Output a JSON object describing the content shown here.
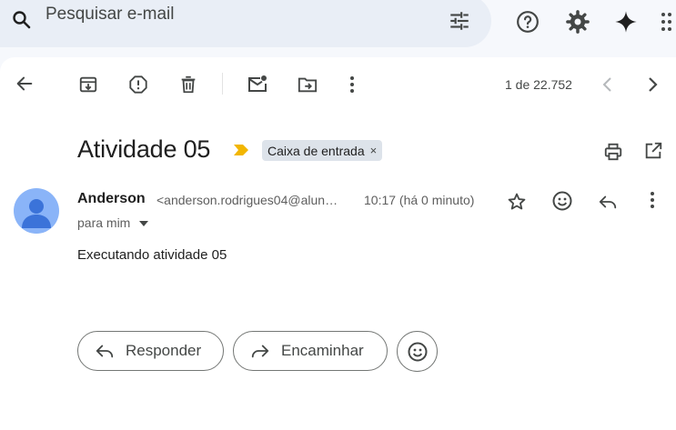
{
  "search": {
    "placeholder": "Pesquisar e-mail"
  },
  "toolbar": {
    "counter": "1 de 22.752"
  },
  "message": {
    "subject": "Atividade 05",
    "label": "Caixa de entrada",
    "label_remove": "×",
    "sender_name": "Anderson",
    "sender_email": "<anderson.rodrigues04@alun…",
    "time": "10:17 (há 0 minuto)",
    "recipient": "para mim",
    "body": "Executando atividade 05"
  },
  "actions": {
    "reply": "Responder",
    "forward": "Encaminhar"
  },
  "colors": {
    "topbar_bg": "#f6f8fc",
    "search_bg": "#e9eef6",
    "panel_bg": "#ffffff",
    "label_chip_bg": "#dde3ea",
    "important_marker": "#f2b600",
    "avatar_bg": "#8ab4f8",
    "avatar_figure": "#3b73d9"
  },
  "icons": [
    "search-icon",
    "filter-options-icon",
    "help-icon",
    "settings-icon",
    "gemini-sparkle-icon",
    "apps-grid-icon",
    "back-arrow-icon",
    "archive-icon",
    "report-spam-icon",
    "delete-icon",
    "mark-unread-icon",
    "move-to-icon",
    "more-vert-icon",
    "chevron-left-icon",
    "chevron-right-icon",
    "important-marker-icon",
    "print-icon",
    "open-new-window-icon",
    "star-icon",
    "emoji-icon",
    "reply-icon",
    "forward-icon",
    "caret-down-icon"
  ]
}
